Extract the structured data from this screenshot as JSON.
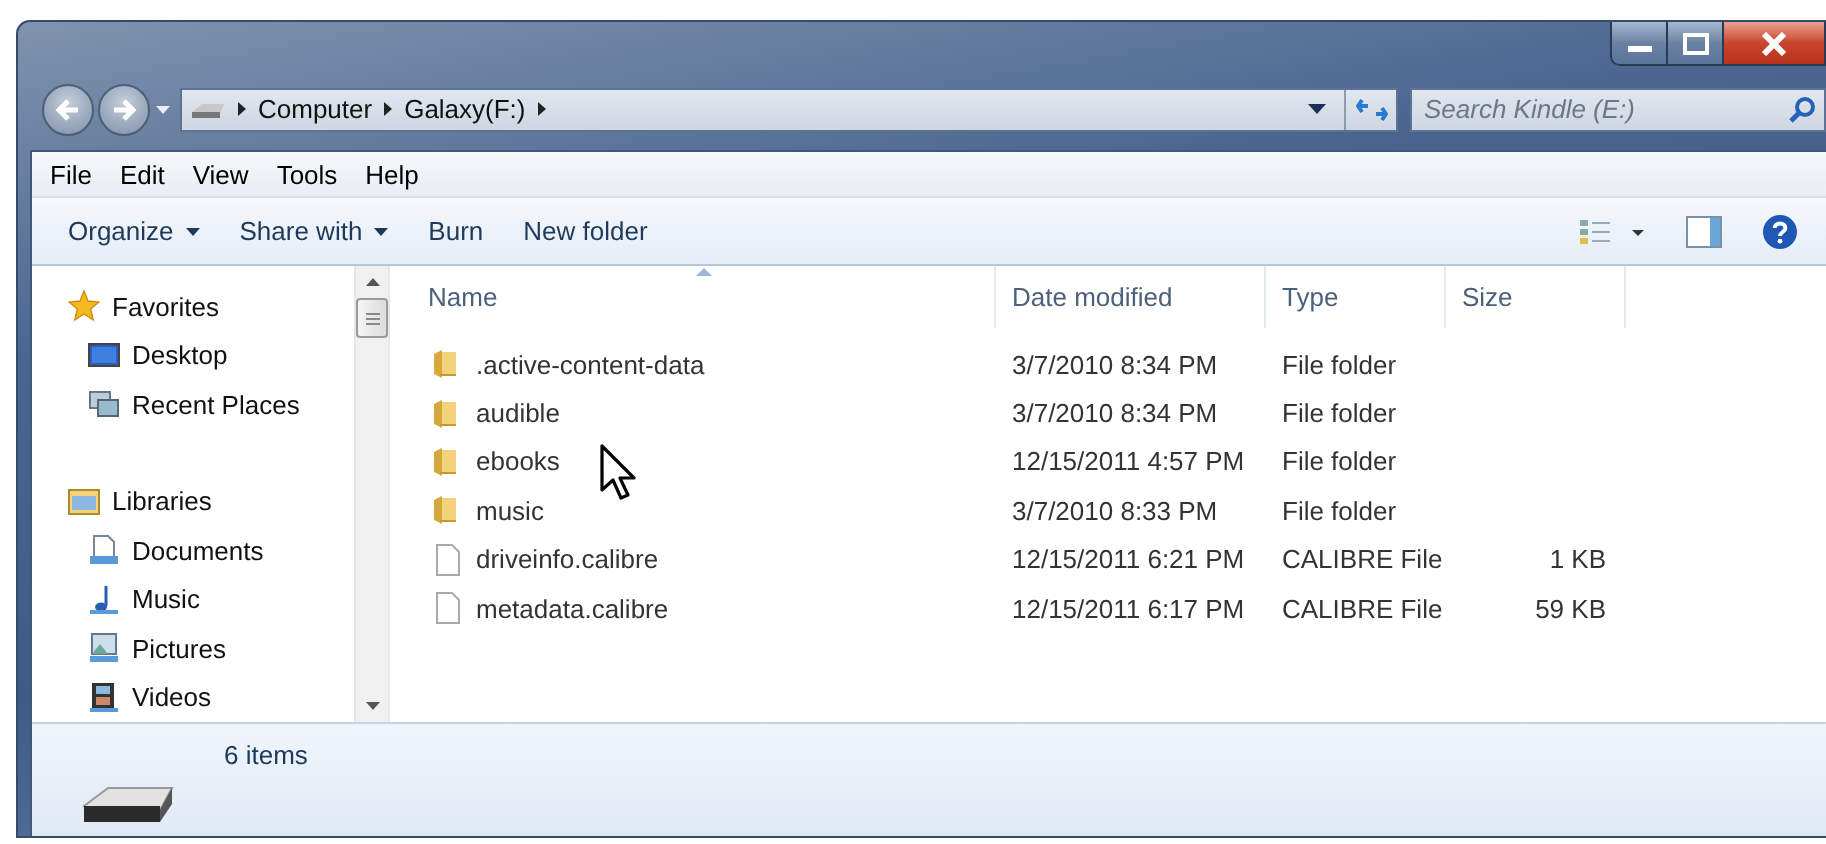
{
  "address": {
    "crumbs": [
      "Computer",
      "Galaxy(F:)"
    ]
  },
  "search": {
    "placeholder": "Search Kindle (E:)"
  },
  "menu": [
    "File",
    "Edit",
    "View",
    "Tools",
    "Help"
  ],
  "commands": [
    {
      "label": "Organize",
      "dropdown": true
    },
    {
      "label": "Share with",
      "dropdown": true
    },
    {
      "label": "Burn",
      "dropdown": false
    },
    {
      "label": "New folder",
      "dropdown": false
    }
  ],
  "sidebar": [
    {
      "label": "Favorites",
      "children": [
        {
          "label": "Desktop"
        },
        {
          "label": "Recent Places"
        }
      ]
    },
    {
      "label": "Libraries",
      "children": [
        {
          "label": "Documents"
        },
        {
          "label": "Music"
        },
        {
          "label": "Pictures"
        },
        {
          "label": "Videos"
        }
      ]
    }
  ],
  "columns": [
    {
      "label": "Name",
      "sorted": true
    },
    {
      "label": "Date modified",
      "sorted": false
    },
    {
      "label": "Type",
      "sorted": false
    },
    {
      "label": "Size",
      "sorted": false
    }
  ],
  "rows": [
    {
      "kind": "folder",
      "name": ".active-content-data",
      "date": "3/7/2010 8:34 PM",
      "type": "File folder"
    },
    {
      "kind": "folder",
      "name": "audible",
      "date": "3/7/2010 8:34 PM",
      "type": "File folder"
    },
    {
      "kind": "folder",
      "name": "ebooks",
      "date": "12/15/2011 4:57 PM",
      "type": "File folder"
    },
    {
      "kind": "folder",
      "name": "music",
      "date": "3/7/2010 8:33 PM",
      "type": "File folder"
    },
    {
      "kind": "file",
      "name": "driveinfo.calibre",
      "date": "12/15/2011 6:21 PM",
      "type": "CALIBRE File",
      "size": "1 KB"
    },
    {
      "kind": "file",
      "name": "metadata.calibre",
      "date": "12/15/2011 6:17 PM",
      "type": "CALIBRE File",
      "size": "59 KB"
    }
  ],
  "status": {
    "count": "6 items"
  }
}
